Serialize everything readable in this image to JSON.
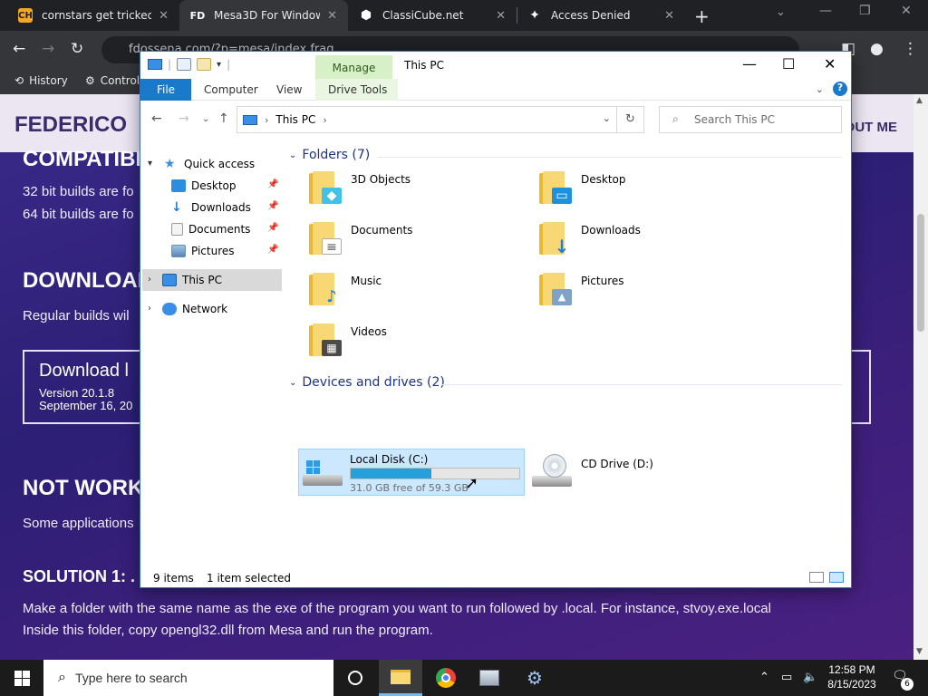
{
  "browser": {
    "tabs": [
      {
        "label": "cornstars get tricked in",
        "favicon": "CH"
      },
      {
        "label": "Mesa3D For Windows - ",
        "favicon": "FD"
      },
      {
        "label": "ClassiCube.net",
        "favicon": "⬢"
      },
      {
        "label": "Access Denied",
        "favicon": "✦"
      }
    ],
    "new_tab": "+",
    "address": "fdossena.com/?p=mesa/index.frag",
    "bookmarks": [
      {
        "label": "History"
      },
      {
        "label": "Control"
      }
    ]
  },
  "webpage": {
    "brand": "FEDERICO",
    "about_me": "OUT ME",
    "compat_heading": "COMPATIBI",
    "line_32bit": "32 bit builds are fo",
    "line_64bit": "64 bit builds are fo",
    "download_heading": "DOWNLOAD",
    "regular_builds": "Regular builds wil",
    "download_box": {
      "title": "Download l",
      "version": "Version 20.1.8",
      "date": "September 16, 20"
    },
    "not_working_heading": "NOT WORK",
    "some_apps": "Some applications",
    "solution_heading": "SOLUTION 1: .",
    "para1": "Make a folder with the same name as the exe of the program you want to run followed by .local. For instance, stvoy.exe.local",
    "para2": "Inside this folder, copy opengl32.dll from Mesa and run the program."
  },
  "explorer": {
    "title": "This PC",
    "manage_tab": "Manage",
    "ribbon_tabs": {
      "file": "File",
      "computer": "Computer",
      "view": "View",
      "drive_tools": "Drive Tools"
    },
    "breadcrumb": "This PC",
    "search_placeholder": "Search This PC",
    "nav": {
      "quick_access": "Quick access",
      "desktop": "Desktop",
      "downloads": "Downloads",
      "documents": "Documents",
      "pictures": "Pictures",
      "this_pc": "This PC",
      "network": "Network"
    },
    "folders_header": "Folders (7)",
    "folders": [
      {
        "name": "3D Objects",
        "badge_color": "#3fc1e8",
        "badge": "◆"
      },
      {
        "name": "Desktop",
        "badge_color": "#1e90e0",
        "badge": "▭"
      },
      {
        "name": "Documents",
        "badge_color": "#ffffff",
        "badge": "≡"
      },
      {
        "name": "Downloads",
        "badge_color": "#1e7fe0",
        "badge": "↓"
      },
      {
        "name": "Music",
        "badge_color": "#1e7fe0",
        "badge": "♪"
      },
      {
        "name": "Pictures",
        "badge_color": "#7fa3c8",
        "badge": "▲"
      },
      {
        "name": "Videos",
        "badge_color": "#4a4a4a",
        "badge": "▦"
      }
    ],
    "drives_header": "Devices and drives (2)",
    "drives": {
      "c_name": "Local Disk (C:)",
      "c_free": "31.0 GB free of 59.3 GB",
      "c_used_fraction": 0.477,
      "d_name": "CD Drive (D:)"
    },
    "status": {
      "items": "9 items",
      "selected": "1 item selected"
    }
  },
  "taskbar": {
    "search_placeholder": "Type here to search",
    "time": "12:58 PM",
    "date": "8/15/2023",
    "notifications": "6"
  },
  "colors": {
    "accent": "#1979ca",
    "selection": "#cce8ff",
    "drive_fill": "#26a0da"
  }
}
